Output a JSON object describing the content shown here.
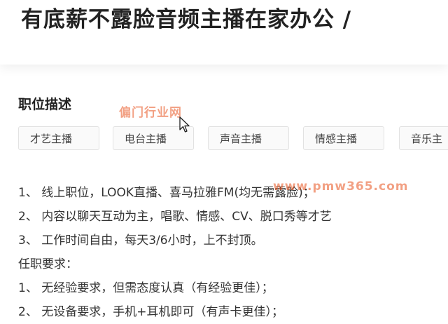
{
  "header": {
    "title": "有底薪不露脸音频主播在家办公 /"
  },
  "description": {
    "heading": "职位描述",
    "tags": [
      "才艺主播",
      "电台主播",
      "声音主播",
      "情感主播",
      "音乐主"
    ],
    "lines": [
      "1、 线上职位，LOOK直播、喜马拉雅FM(均无需露脸)；",
      "2、 内容以聊天互动为主，唱歌、情感、CV、脱口秀等才艺",
      "3、 工作时间自由，每天3/6小时，上不封顶。",
      "任职要求：",
      "1、 无经验要求，但需态度认真（有经验更佳）；",
      "2、 无设备要求，手机+耳机即可（有声卡更佳）；"
    ]
  },
  "watermarks": [
    "偏门行业网",
    "www.pmw365.com"
  ],
  "icons": {
    "cursor": "mouse-pointer-icon"
  }
}
